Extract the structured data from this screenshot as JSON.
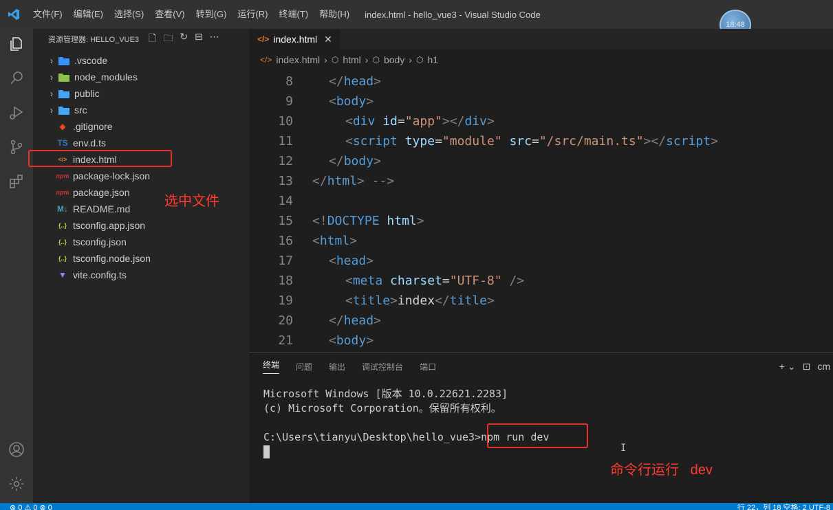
{
  "titlebar": {
    "menu": [
      "文件(F)",
      "编辑(E)",
      "选择(S)",
      "查看(V)",
      "转到(G)",
      "运行(R)",
      "终端(T)",
      "帮助(H)"
    ],
    "window_title": "index.html - hello_vue3 - Visual Studio Code",
    "clock": "18:48"
  },
  "activitybar": {
    "icons": [
      "explorer-icon",
      "search-icon",
      "run-debug-icon",
      "source-control-icon",
      "extensions-icon",
      "account-icon",
      "settings-gear-icon"
    ]
  },
  "sidebar": {
    "header": "资源管理器: HELLO_VUE3",
    "items": [
      {
        "label": ".vscode",
        "type": "folder",
        "icon": "vscode-folder-icon",
        "icon_color": "#3794ff"
      },
      {
        "label": "node_modules",
        "type": "folder",
        "icon": "node-modules-folder-icon",
        "icon_color": "#8bc34a"
      },
      {
        "label": "public",
        "type": "folder",
        "icon": "folder-icon",
        "icon_color": "#42a5f5"
      },
      {
        "label": "src",
        "type": "folder",
        "icon": "folder-icon",
        "icon_color": "#42a5f5"
      },
      {
        "label": ".gitignore",
        "type": "file",
        "icon": "git-icon",
        "glyph": "◆",
        "icon_color": "#e64a19"
      },
      {
        "label": "env.d.ts",
        "type": "file",
        "icon": "typescript-icon",
        "glyph": "TS",
        "icon_color": "#3178c6"
      },
      {
        "label": "index.html",
        "type": "file",
        "icon": "html-icon",
        "glyph": "</>",
        "icon_color": "#e37933"
      },
      {
        "label": "package-lock.json",
        "type": "file",
        "icon": "npm-icon",
        "glyph": "npm",
        "icon_color": "#cb3837"
      },
      {
        "label": "package.json",
        "type": "file",
        "icon": "npm-icon",
        "glyph": "npm",
        "icon_color": "#cb3837"
      },
      {
        "label": "README.md",
        "type": "file",
        "icon": "markdown-icon",
        "glyph": "M↓",
        "icon_color": "#519aba"
      },
      {
        "label": "tsconfig.app.json",
        "type": "file",
        "icon": "json-icon",
        "glyph": "{..}",
        "icon_color": "#cbcb41"
      },
      {
        "label": "tsconfig.json",
        "type": "file",
        "icon": "json-icon",
        "glyph": "{..}",
        "icon_color": "#cbcb41"
      },
      {
        "label": "tsconfig.node.json",
        "type": "file",
        "icon": "json-icon",
        "glyph": "{..}",
        "icon_color": "#cbcb41"
      },
      {
        "label": "vite.config.ts",
        "type": "file",
        "icon": "vite-icon",
        "glyph": "▼",
        "icon_color": "#a67bff"
      }
    ],
    "annotation": "选中文件"
  },
  "editor": {
    "tab_label": "index.html",
    "breadcrumb": [
      "index.html",
      "html",
      "body",
      "h1"
    ],
    "lines": [
      {
        "n": "8",
        "indent": 1,
        "parts": [
          [
            "gray",
            "</"
          ],
          [
            "tag",
            "head"
          ],
          [
            "gray",
            ">"
          ]
        ]
      },
      {
        "n": "9",
        "indent": 1,
        "parts": [
          [
            "gray",
            "<"
          ],
          [
            "tag",
            "body"
          ],
          [
            "gray",
            ">"
          ]
        ]
      },
      {
        "n": "10",
        "indent": 2,
        "parts": [
          [
            "gray",
            "<"
          ],
          [
            "tag",
            "div"
          ],
          [
            "txt",
            " "
          ],
          [
            "attr",
            "id"
          ],
          [
            "txt",
            "="
          ],
          [
            "str",
            "\"app\""
          ],
          [
            "gray",
            "></"
          ],
          [
            "tag",
            "div"
          ],
          [
            "gray",
            ">"
          ]
        ]
      },
      {
        "n": "11",
        "indent": 2,
        "parts": [
          [
            "gray",
            "<"
          ],
          [
            "tag",
            "script"
          ],
          [
            "txt",
            " "
          ],
          [
            "attr",
            "type"
          ],
          [
            "txt",
            "="
          ],
          [
            "str",
            "\"module\""
          ],
          [
            "txt",
            " "
          ],
          [
            "attr",
            "src"
          ],
          [
            "txt",
            "="
          ],
          [
            "str",
            "\"/src/main.ts\""
          ],
          [
            "gray",
            "></"
          ],
          [
            "tag",
            "script"
          ],
          [
            "gray",
            ">"
          ]
        ]
      },
      {
        "n": "12",
        "indent": 1,
        "parts": [
          [
            "gray",
            "</"
          ],
          [
            "tag",
            "body"
          ],
          [
            "gray",
            ">"
          ]
        ]
      },
      {
        "n": "13",
        "indent": 0,
        "parts": [
          [
            "gray",
            "</"
          ],
          [
            "tag",
            "html"
          ],
          [
            "gray",
            "> -->"
          ]
        ]
      },
      {
        "n": "14",
        "indent": 0,
        "parts": []
      },
      {
        "n": "15",
        "indent": 0,
        "parts": [
          [
            "gray",
            "<!"
          ],
          [
            "tag",
            "DOCTYPE"
          ],
          [
            "txt",
            " "
          ],
          [
            "attr",
            "html"
          ],
          [
            "gray",
            ">"
          ]
        ]
      },
      {
        "n": "16",
        "indent": 0,
        "parts": [
          [
            "gray",
            "<"
          ],
          [
            "tag",
            "html"
          ],
          [
            "gray",
            ">"
          ]
        ]
      },
      {
        "n": "17",
        "indent": 1,
        "parts": [
          [
            "gray",
            "<"
          ],
          [
            "tag",
            "head"
          ],
          [
            "gray",
            ">"
          ]
        ]
      },
      {
        "n": "18",
        "indent": 2,
        "parts": [
          [
            "gray",
            "<"
          ],
          [
            "tag",
            "meta"
          ],
          [
            "txt",
            " "
          ],
          [
            "attr",
            "charset"
          ],
          [
            "txt",
            "="
          ],
          [
            "str",
            "\"UTF-8\""
          ],
          [
            "txt",
            " "
          ],
          [
            "gray",
            "/>"
          ]
        ]
      },
      {
        "n": "19",
        "indent": 2,
        "parts": [
          [
            "gray",
            "<"
          ],
          [
            "tag",
            "title"
          ],
          [
            "gray",
            ">"
          ],
          [
            "txt",
            "index"
          ],
          [
            "gray",
            "</"
          ],
          [
            "tag",
            "title"
          ],
          [
            "gray",
            ">"
          ]
        ]
      },
      {
        "n": "20",
        "indent": 1,
        "parts": [
          [
            "gray",
            "</"
          ],
          [
            "tag",
            "head"
          ],
          [
            "gray",
            ">"
          ]
        ]
      },
      {
        "n": "21",
        "indent": 1,
        "parts": [
          [
            "gray",
            "<"
          ],
          [
            "tag",
            "body"
          ],
          [
            "gray",
            ">"
          ]
        ]
      }
    ]
  },
  "panel": {
    "tabs": [
      "终端",
      "问题",
      "输出",
      "调试控制台",
      "端口"
    ],
    "active_tab": "终端",
    "terminal_lines": [
      "Microsoft Windows [版本 10.0.22621.2283]",
      "(c) Microsoft Corporation。保留所有权利。",
      "",
      "C:\\Users\\tianyu\\Desktop\\hello_vue3>npm run dev"
    ],
    "terminal_shell_label": "cm",
    "annotation": "命令行运行   dev"
  },
  "statusbar": {
    "left": "⊗ 0 ⚠ 0   ⊗ 0",
    "right": "行 22，列 18   空格: 2   UTF-8"
  }
}
